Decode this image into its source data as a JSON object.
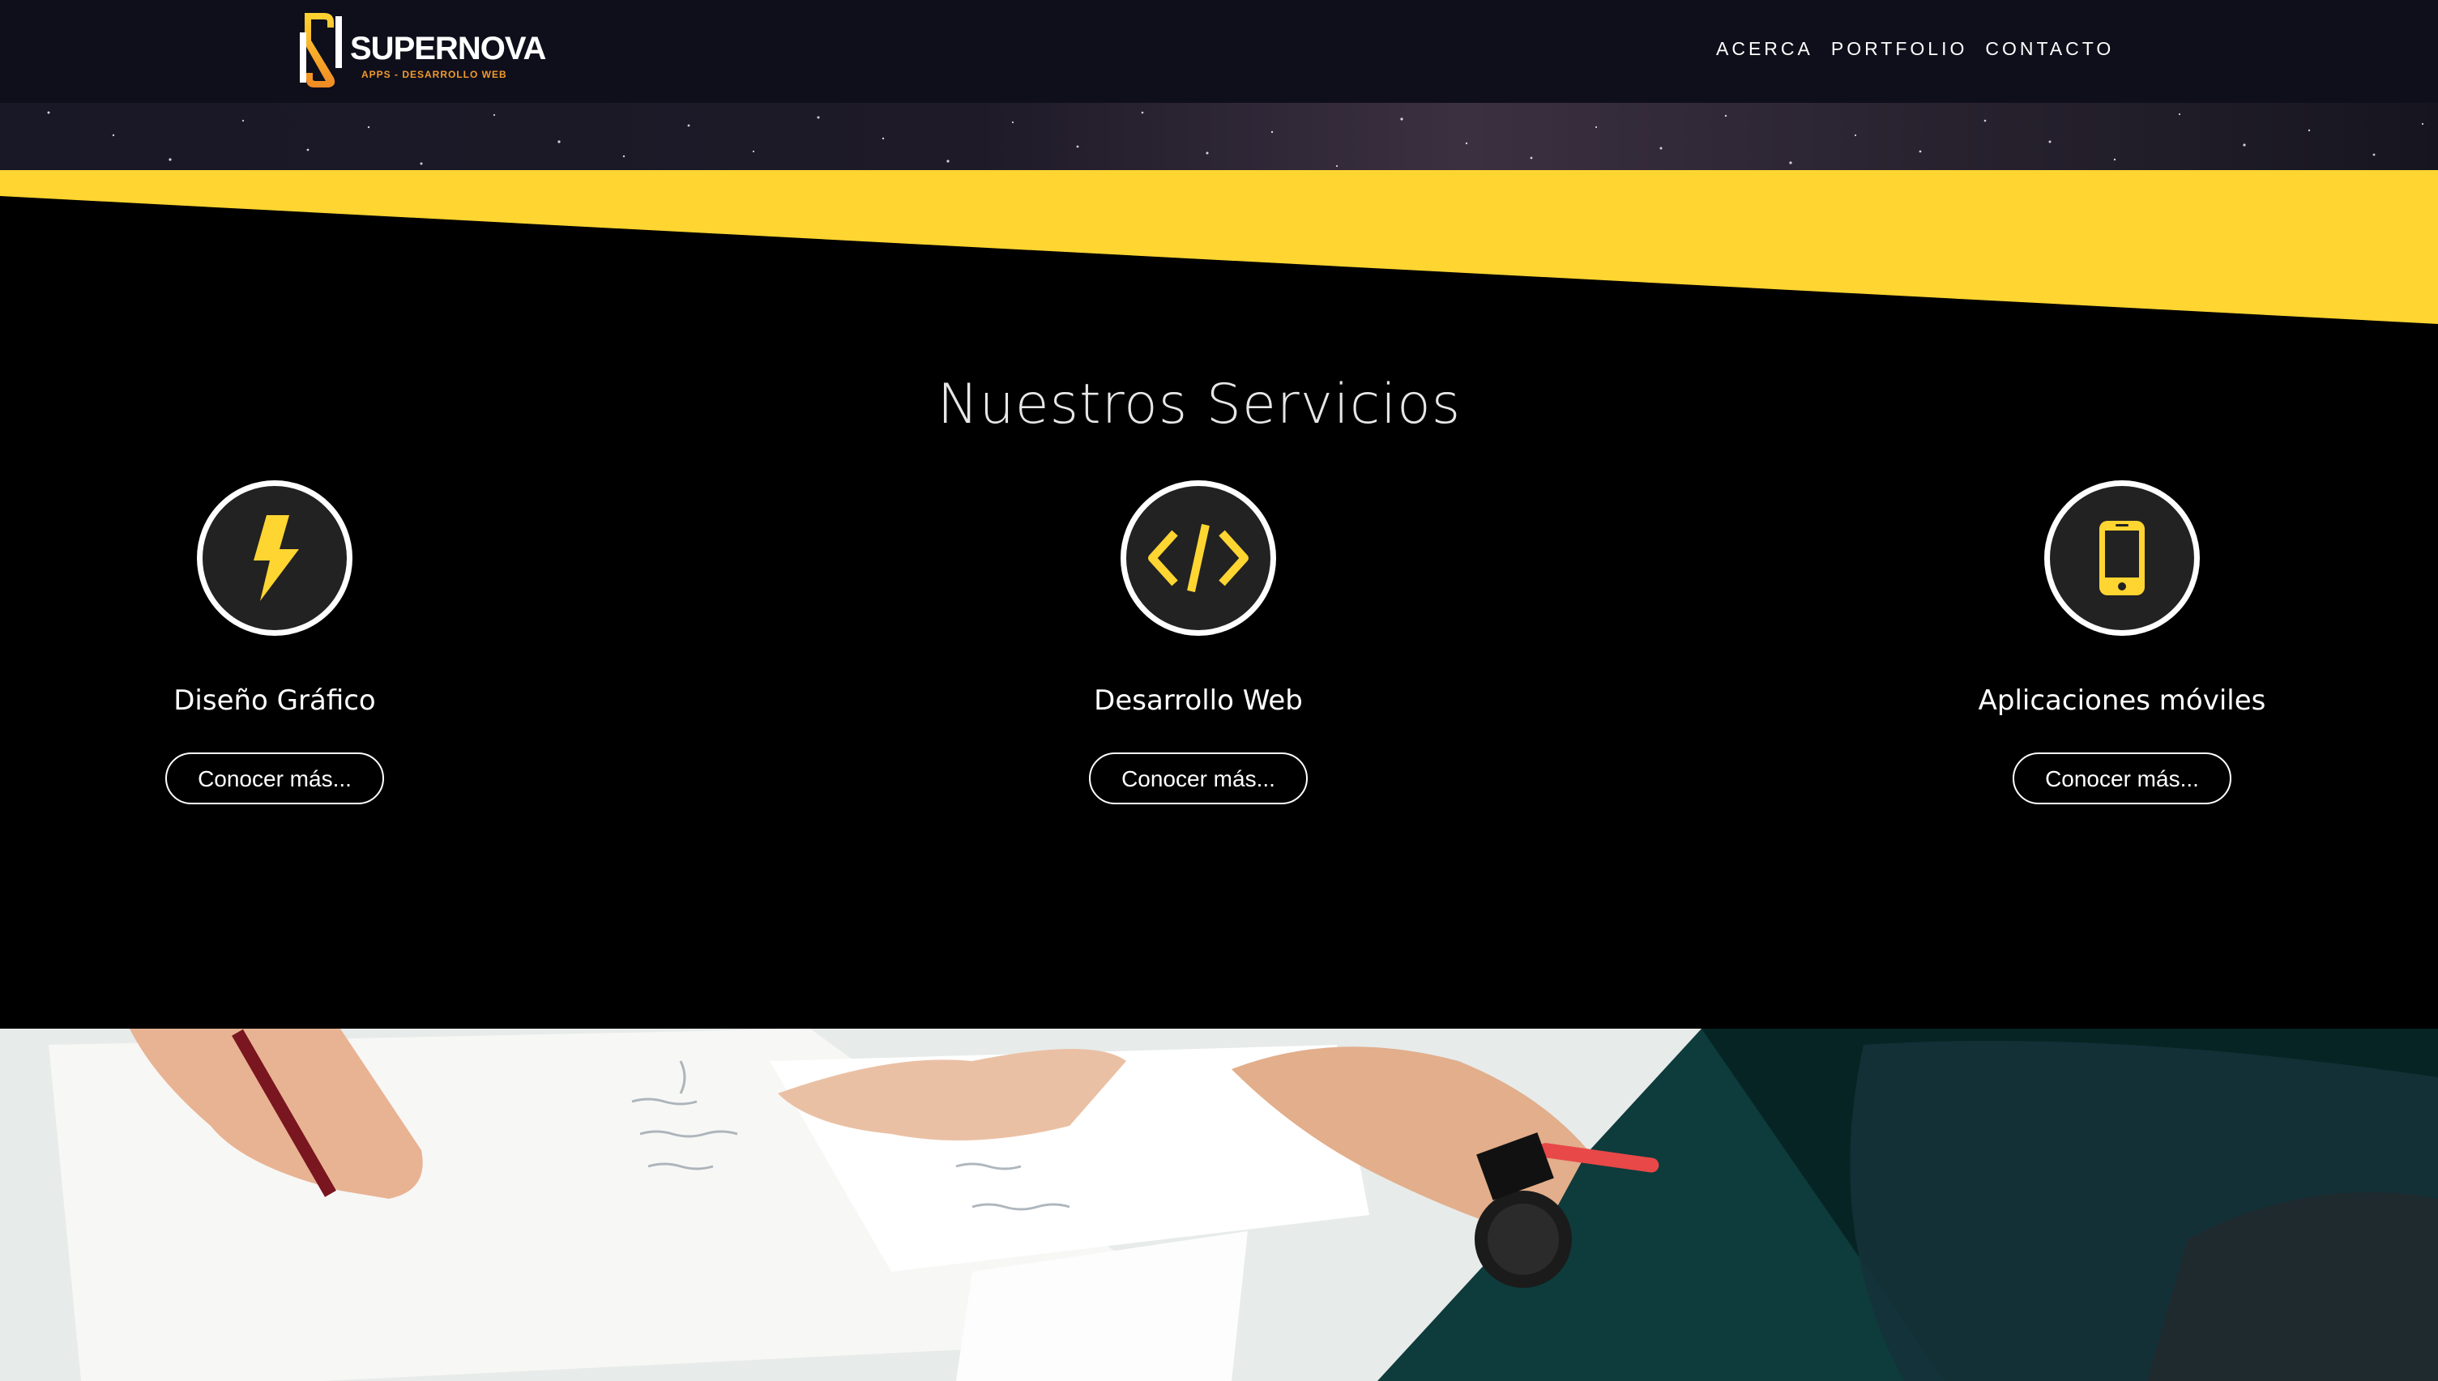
{
  "header": {
    "brand_name": "SUPERNOVA",
    "brand_tagline": "APPS - DESARROLLO WEB",
    "nav": [
      {
        "label": "ACERCA"
      },
      {
        "label": "PORTFOLIO"
      },
      {
        "label": "CONTACTO"
      }
    ]
  },
  "services": {
    "title": "Nuestros Servicios",
    "items": [
      {
        "icon": "lightning-icon",
        "name": "Diseño Gráfico",
        "button": "Conocer más..."
      },
      {
        "icon": "code-icon",
        "name": "Desarrollo Web",
        "button": "Conocer más..."
      },
      {
        "icon": "smartphone-icon",
        "name": "Aplicaciones móviles",
        "button": "Conocer más..."
      }
    ]
  },
  "colors": {
    "accent_yellow": "#ffd531",
    "navbar_bg": "#0f0f1b",
    "section_bg": "#000000",
    "icon_circle_bg": "#222222"
  }
}
